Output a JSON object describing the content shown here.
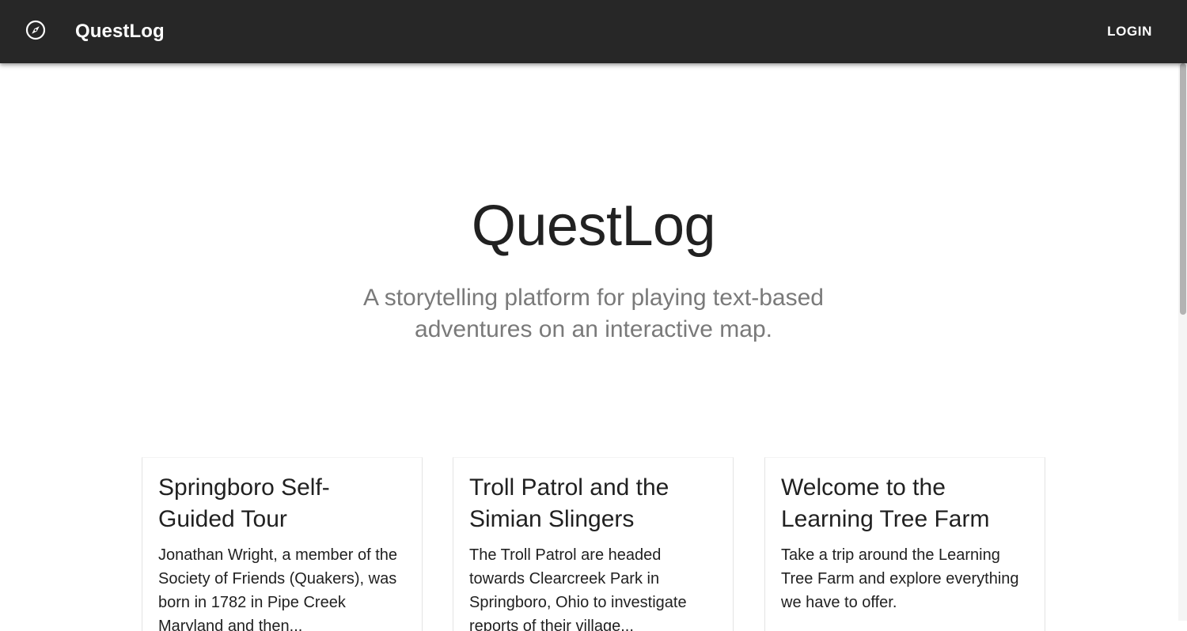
{
  "app_bar": {
    "icon": "compass-icon",
    "brand": "QuestLog",
    "login_label": "LOGIN",
    "background": "#272727"
  },
  "hero": {
    "title": "QuestLog",
    "subtitle": "A storytelling platform for playing text-based adventures on an interactive map."
  },
  "cards": [
    {
      "title": "Springboro Self-Guided Tour",
      "text": "Jonathan Wright, a member of the Society of Friends (Quakers), was born in 1782 in Pipe Creek Maryland and then..."
    },
    {
      "title": "Troll Patrol and the Simian Slingers",
      "text": "The Troll Patrol are headed towards Clearcreek Park in Springboro, Ohio to investigate reports of their village..."
    },
    {
      "title": "Welcome to the Learning Tree Farm",
      "text": "Take a trip around the Learning Tree Farm and explore everything we have to offer."
    }
  ]
}
